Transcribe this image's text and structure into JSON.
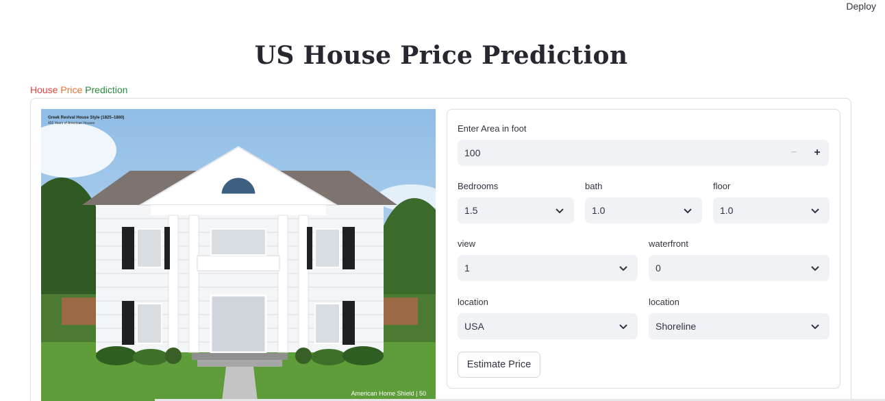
{
  "header": {
    "deploy_label": "Deploy"
  },
  "page": {
    "title": "US House Price Prediction",
    "subtitle_part1": "House ",
    "subtitle_part2": "Price",
    "subtitle_part3": " Prediction"
  },
  "image": {
    "caption_title": "Greek Revival House Style (1825–1860)",
    "caption_sub": "450 Years of American Houses",
    "logo_text": "American Home Shield | 50"
  },
  "form": {
    "area": {
      "label": "Enter Area in foot",
      "value": "100",
      "minus": "−",
      "plus": "+"
    },
    "bedrooms": {
      "label": "Bedrooms",
      "value": "1.5"
    },
    "bath": {
      "label": "bath",
      "value": "1.0"
    },
    "floor": {
      "label": "floor",
      "value": "1.0"
    },
    "view": {
      "label": "view",
      "value": "1"
    },
    "waterfront": {
      "label": "waterfront",
      "value": "0"
    },
    "location1": {
      "label": "location",
      "value": "USA"
    },
    "location2": {
      "label": "location",
      "value": "Shoreline"
    },
    "submit_label": "Estimate Price"
  },
  "colors": {
    "accent_red": "#e8453c",
    "accent_orange": "#e8712c",
    "accent_green": "#2b8a3e",
    "field_bg": "#f0f2f6"
  }
}
